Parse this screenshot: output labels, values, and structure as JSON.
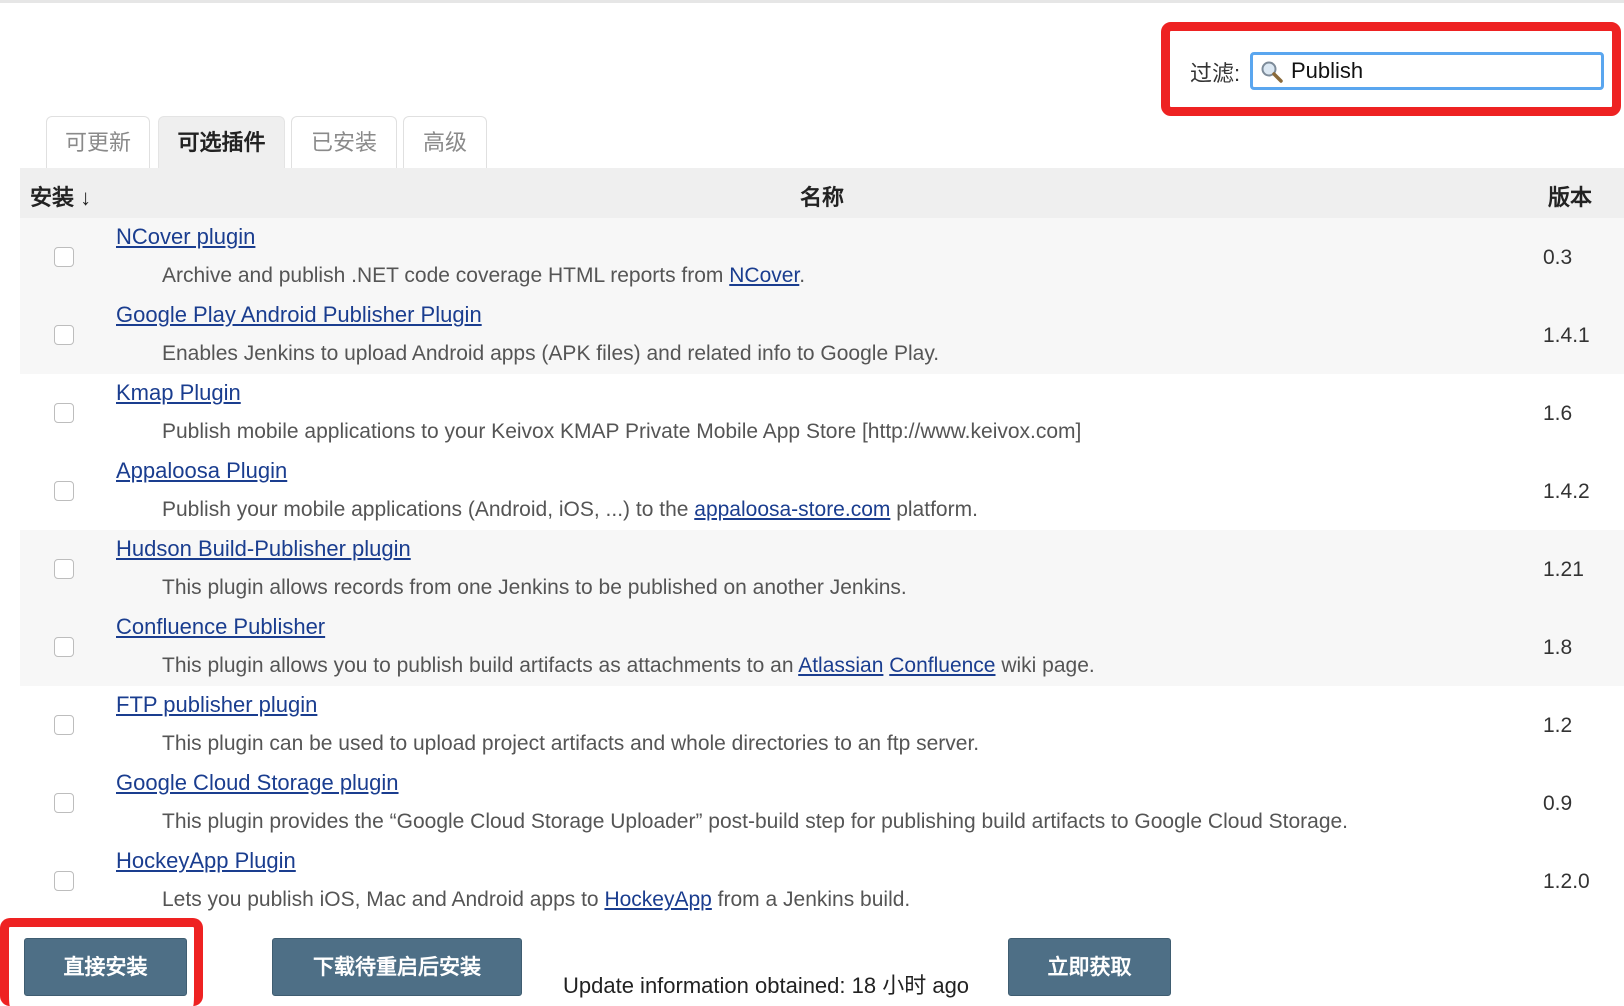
{
  "filter": {
    "label": "过滤:",
    "value": "Publish"
  },
  "tabs": [
    {
      "label": "可更新",
      "active": false
    },
    {
      "label": "可选插件",
      "active": true
    },
    {
      "label": "已安装",
      "active": false
    },
    {
      "label": "高级",
      "active": false
    }
  ],
  "table": {
    "headers": {
      "install": "安装 ↓",
      "name": "名称",
      "version": "版本"
    },
    "rows": [
      {
        "name": "NCover plugin",
        "desc": "Archive and publish .NET code coverage HTML reports from ",
        "link1": "NCover",
        "desc_after": ".",
        "version": "0.3",
        "checked": false
      },
      {
        "name": "Google Play Android Publisher Plugin",
        "desc": "Enables Jenkins to upload Android apps (APK files) and related info to Google Play.",
        "version": "1.4.1",
        "checked": false
      },
      {
        "name": "Kmap Plugin",
        "desc": "Publish mobile applications to your Keivox KMAP Private Mobile App Store [http://www.keivox.com]",
        "version": "1.6",
        "checked": false
      },
      {
        "name": "Appaloosa Plugin",
        "desc": "Publish your mobile applications (Android, iOS, ...) to the ",
        "link1": "appaloosa-store.com",
        "desc_after": " platform.",
        "version": "1.4.2",
        "checked": false
      },
      {
        "name": "Hudson Build-Publisher plugin",
        "desc": "This plugin allows records from one Jenkins to be published on another Jenkins.",
        "version": "1.21",
        "checked": false
      },
      {
        "name": "Confluence Publisher",
        "desc": "This plugin allows you to publish build artifacts as attachments to an ",
        "link1": "Atlassian",
        "desc_mid": " ",
        "link2": "Confluence",
        "desc_after": " wiki page.",
        "version": "1.8",
        "checked": false
      },
      {
        "name": "FTP publisher plugin",
        "desc": "This plugin can be used to upload project artifacts and whole directories to an ftp server.",
        "version": "1.2",
        "checked": false
      },
      {
        "name": "Google Cloud Storage plugin",
        "desc": "This plugin provides the “Google Cloud Storage Uploader” post-build step for publishing build artifacts to Google Cloud Storage.",
        "version": "0.9",
        "checked": false
      },
      {
        "name": "HockeyApp Plugin",
        "desc": "Lets you publish iOS, Mac and Android apps to ",
        "link1": "HockeyApp",
        "desc_after": " from a Jenkins build.",
        "version": "1.2.0",
        "checked": false
      }
    ]
  },
  "bottom": {
    "install_now": "直接安装",
    "install_after_restart": "下载待重启后安装",
    "update_info": "Update information obtained: 18 小时 ago",
    "check_now": "立即获取"
  },
  "colors": {
    "accent_button": "#4e6f86",
    "link": "#1a3d8f",
    "highlight": "#ee2222",
    "input_border": "#5aa6ef"
  },
  "icons": {
    "search": "magnifier-icon"
  }
}
